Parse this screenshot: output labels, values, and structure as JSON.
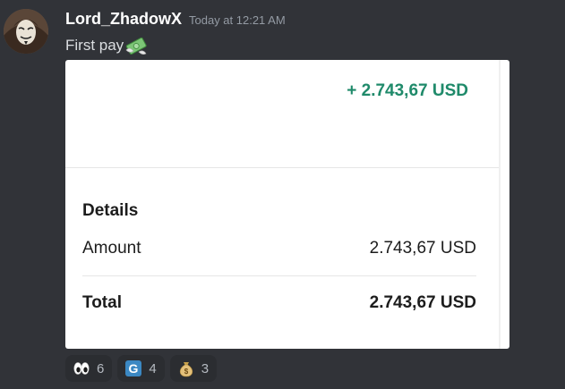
{
  "message": {
    "author": "Lord_ZhadowX",
    "timestamp": "Today at 12:21 AM",
    "content": "First pay",
    "content_emoji": "money-with-wings-icon"
  },
  "attachment": {
    "headline_amount": "+ 2.743,67 USD",
    "details_title": "Details",
    "amount_label": "Amount",
    "amount_value": "2.743,67 USD",
    "total_label": "Total",
    "total_value": "2.743,67 USD",
    "colors": {
      "headline": "#1f8a6a",
      "card_bg": "#ffffff",
      "text": "#1c1c1c"
    }
  },
  "reactions": [
    {
      "emoji": "eyes-icon",
      "count": "6"
    },
    {
      "emoji": "g-letter-icon",
      "count": "4"
    },
    {
      "emoji": "money-bag-icon",
      "count": "3"
    }
  ],
  "theme": {
    "background": "#313338",
    "username": "#ffffff",
    "timestamp": "#949ba4",
    "message_text": "#dbdee1",
    "reaction_bg": "#2b2d31"
  }
}
